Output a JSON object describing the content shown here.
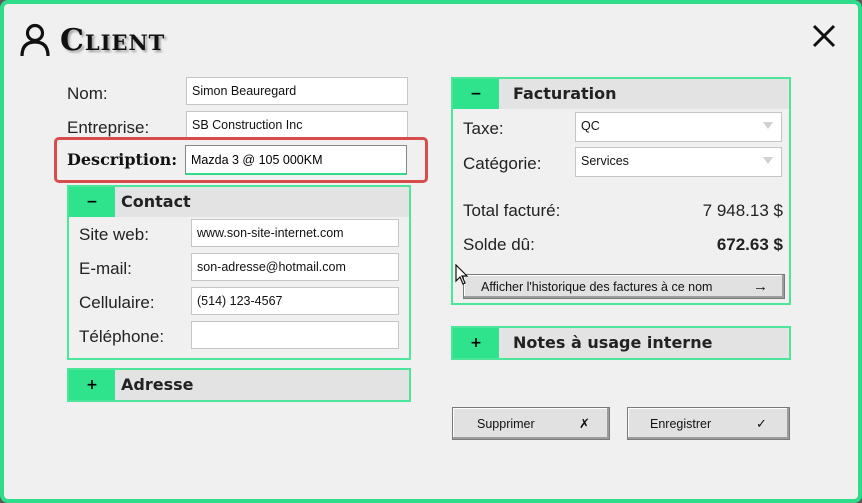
{
  "window": {
    "title": "Client",
    "close_label": "close"
  },
  "client": {
    "name_label": "Nom:",
    "name_value": "Simon Beauregard",
    "company_label": "Entreprise:",
    "company_value": "SB Construction Inc",
    "description_label": "Description:",
    "description_value": "Mazda 3 @ 105 000KM"
  },
  "contact": {
    "toggle": "−",
    "title": "Contact",
    "website_label": "Site web:",
    "website_value": "www.son-site-internet.com",
    "email_label": "E-mail:",
    "email_value": "son-adresse@hotmail.com",
    "mobile_label": "Cellulaire:",
    "mobile_value": "(514) 123-4567",
    "phone_label": "Téléphone:",
    "phone_value": ""
  },
  "address": {
    "toggle": "+",
    "title": "Adresse"
  },
  "billing": {
    "toggle": "−",
    "title": "Facturation",
    "tax_label": "Taxe:",
    "tax_value": "QC",
    "category_label": "Catégorie:",
    "category_value": "Services",
    "total_label": "Total facturé:",
    "total_value": "7 948.13 $",
    "balance_label": "Solde dû:",
    "balance_value": "672.63 $",
    "history_button": "Afficher l'historique des factures à ce nom",
    "history_arrow": "→"
  },
  "notes": {
    "toggle": "+",
    "title": "Notes à usage interne"
  },
  "actions": {
    "delete_label": "Supprimer",
    "delete_symbol": "✗",
    "save_label": "Enregistrer",
    "save_symbol": "✓"
  },
  "colors": {
    "accent": "#2fdc8a",
    "highlight": "#d94c4c"
  }
}
